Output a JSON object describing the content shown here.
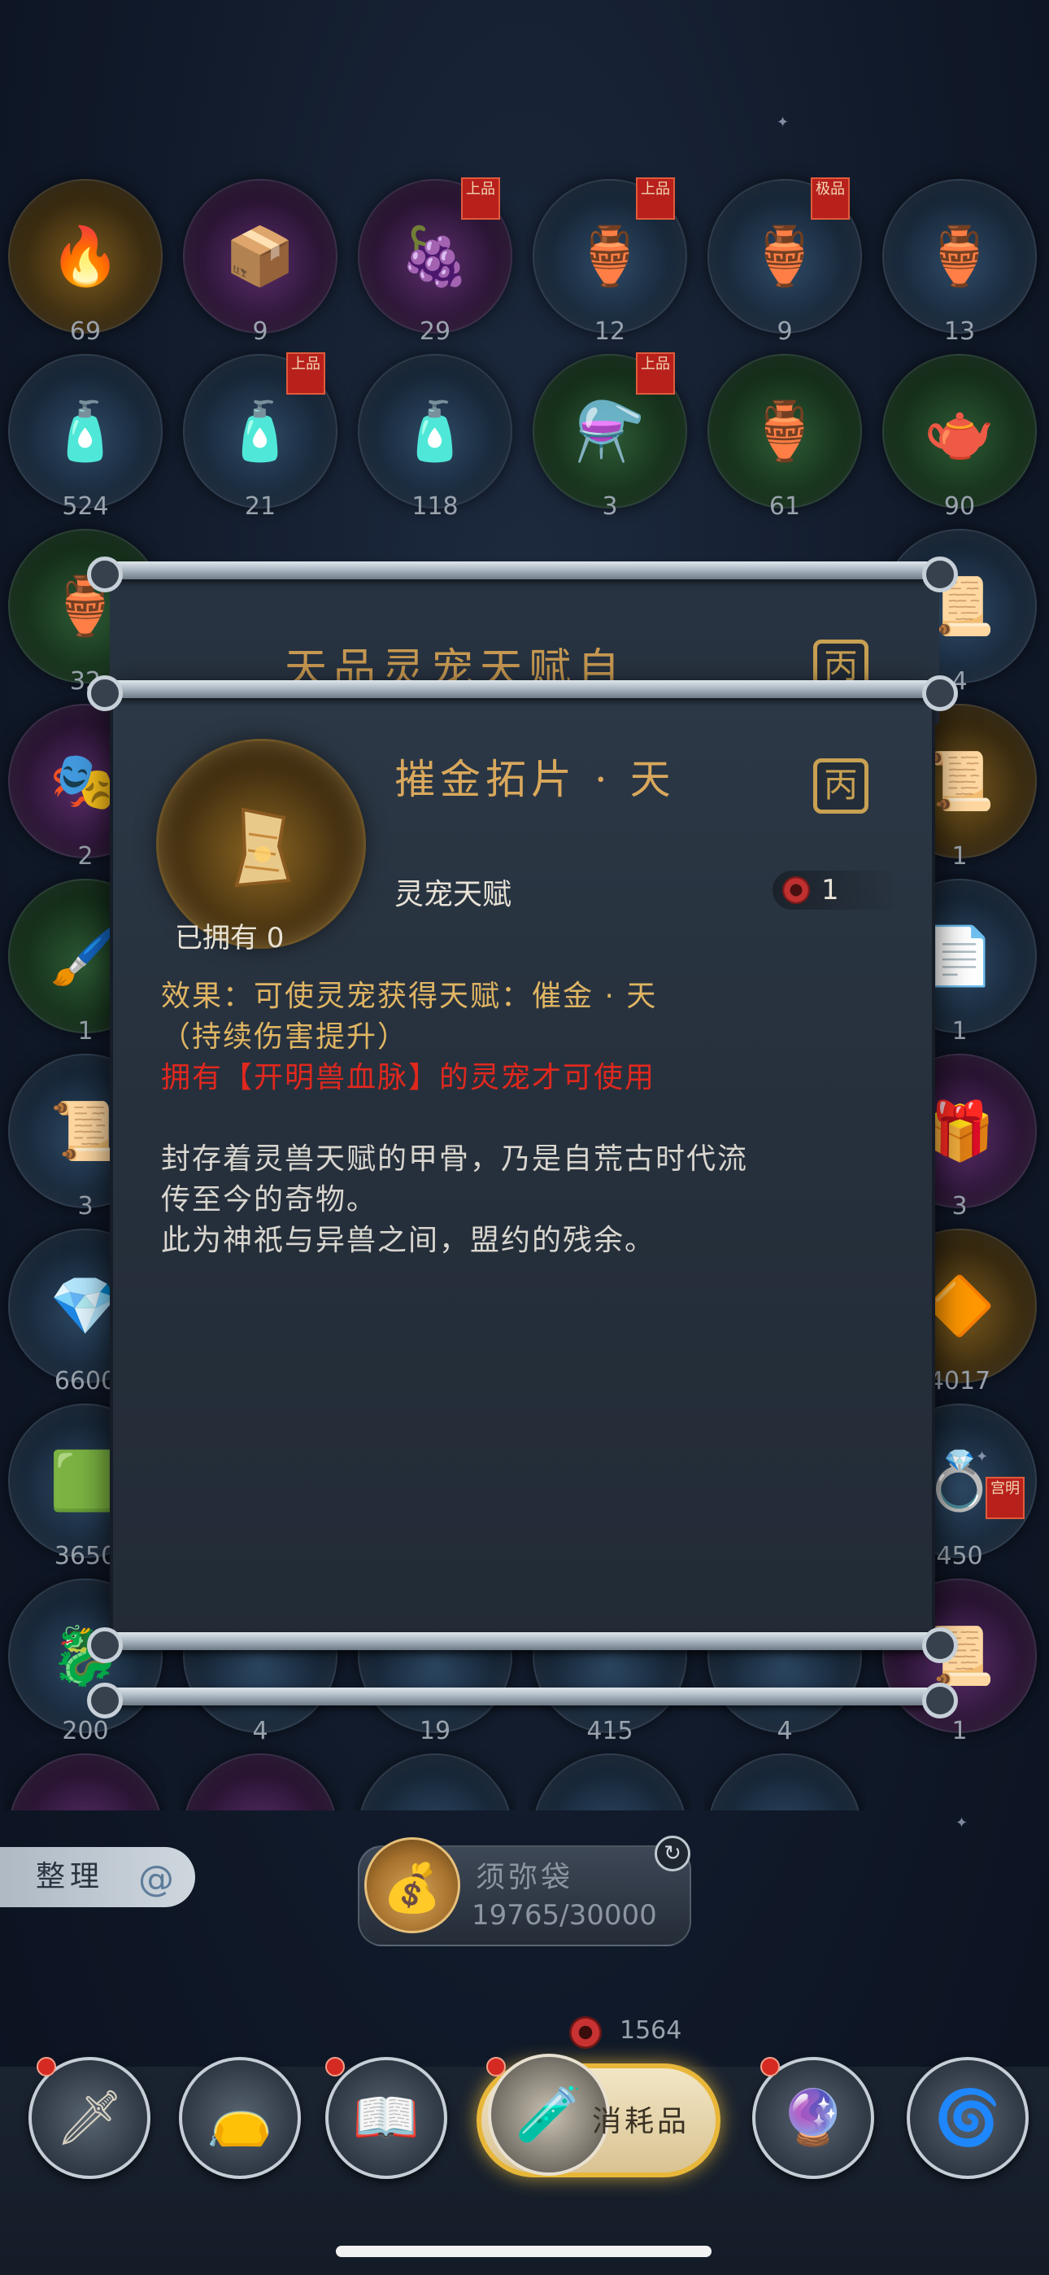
{
  "inventory": {
    "counts": [
      "69",
      "9",
      "29",
      "12",
      "9",
      "13",
      "524",
      "21",
      "118",
      "3",
      "61",
      "90",
      "200",
      "4",
      "19",
      "415",
      "4",
      "1"
    ],
    "side_counts": {
      "left": [
        "32",
        "2",
        "1",
        "3",
        "6600",
        "3650"
      ],
      "right": [
        "4",
        "1",
        "1",
        "3",
        "4017",
        "450"
      ]
    },
    "badges": {
      "shangpin": "上品",
      "jipin": "极品"
    },
    "side_badge": "宫明"
  },
  "back_dialog": {
    "title": "天品灵宠天赋自"
  },
  "popup": {
    "item_name": "摧金拓片 · 天",
    "category": "灵宠天赋",
    "price": "1",
    "owned": "已拥有 0",
    "tag_glyph": "丙",
    "effect_line1": "效果：可使灵宠获得天赋：催金 · 天",
    "effect_line2": "（持续伤害提升）",
    "requirement": "拥有【开明兽血脉】的灵宠才可使用",
    "lore_line1": "封存着灵兽天赋的甲骨，乃是自荒古时代流",
    "lore_line2": "传至今的奇物。",
    "lore_line3": "此为神祇与异兽之间，盟约的残余。"
  },
  "bottom": {
    "sort_label": "整理",
    "bag_title": "须弥袋",
    "bag_capacity": "19765/30000",
    "currency_value": "1564",
    "active_tab_label": "消耗品"
  },
  "colors": {
    "accent_gold": "#d9a85c",
    "warning_red": "#e0281e",
    "panel_bg": "#26303c"
  },
  "icons": {
    "item": "scroll-fragment-icon",
    "price": "spirit-gem-icon",
    "bag": "treasure-bag-icon",
    "refresh": "refresh-icon",
    "tabs": [
      "mask-weapon-icon",
      "pouch-icon",
      "book-icon",
      "potion-icon",
      "crystal-icon",
      "swirl-icon"
    ]
  }
}
